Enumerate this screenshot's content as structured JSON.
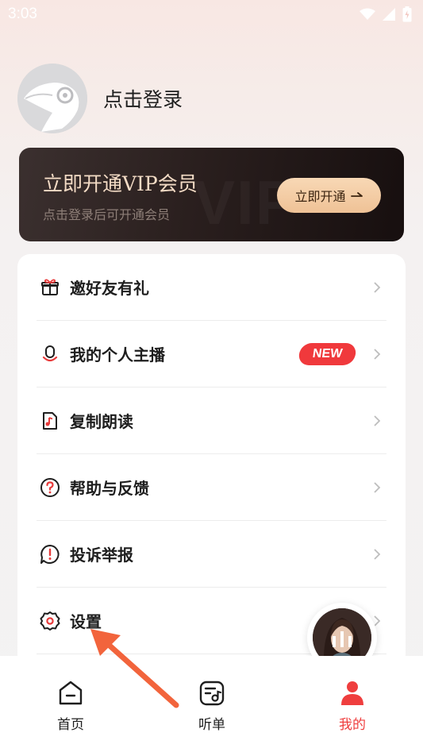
{
  "status_bar": {
    "time": "3:03",
    "icons": [
      "wifi-icon",
      "signal-icon",
      "battery-icon"
    ]
  },
  "profile": {
    "avatar_icon": "default-avatar-icon",
    "login_label": "点击登录"
  },
  "vip_banner": {
    "title": "立即开通VIP会员",
    "subtitle": "点击登录后可开通会员",
    "button_label": "立即开通",
    "button_icon": "arrow-right-icon",
    "watermark": "VIP"
  },
  "menu": {
    "items": [
      {
        "label": "邀好友有礼",
        "icon": "gift-icon"
      },
      {
        "label": "我的个人主播",
        "icon": "microphone-icon",
        "badge": "NEW"
      },
      {
        "label": "复制朗读",
        "icon": "music-document-icon"
      },
      {
        "label": "帮助与反馈",
        "icon": "help-icon"
      },
      {
        "label": "投诉举报",
        "icon": "report-icon"
      },
      {
        "label": "设置",
        "icon": "gear-icon"
      }
    ]
  },
  "floating_player": {
    "icon": "audio-playing-icon"
  },
  "bottom_nav": {
    "items": [
      {
        "label": "首页",
        "icon": "home-icon",
        "active": false
      },
      {
        "label": "听单",
        "icon": "playlist-icon",
        "active": false
      },
      {
        "label": "我的",
        "icon": "profile-icon",
        "active": true
      }
    ]
  },
  "colors": {
    "accent_red": "#ef3e3e",
    "vip_gold": "#f3dbc5",
    "annotation_arrow": "#f2643c"
  }
}
